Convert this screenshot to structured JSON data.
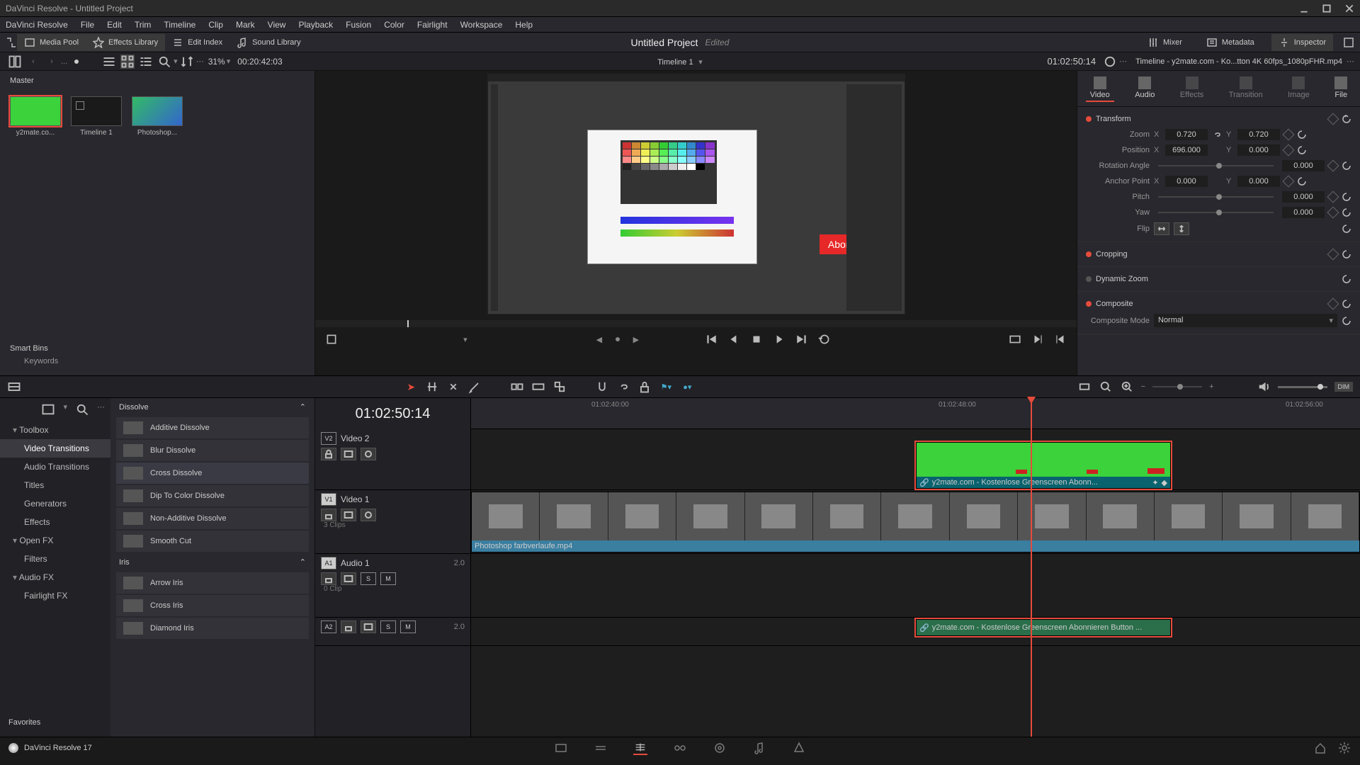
{
  "window": {
    "title": "DaVinci Resolve - Untitled Project"
  },
  "menu": [
    "DaVinci Resolve",
    "File",
    "Edit",
    "Trim",
    "Timeline",
    "Clip",
    "Mark",
    "View",
    "Playback",
    "Fusion",
    "Color",
    "Fairlight",
    "Workspace",
    "Help"
  ],
  "toolbar": {
    "media_pool": "Media Pool",
    "effects_library": "Effects Library",
    "edit_index": "Edit Index",
    "sound_library": "Sound Library",
    "mixer": "Mixer",
    "metadata": "Metadata",
    "inspector": "Inspector"
  },
  "project": {
    "name": "Untitled Project",
    "status": "Edited"
  },
  "subbar": {
    "zoom_pct": "31%",
    "src_tc": "00:20:42:03",
    "timeline_name": "Timeline 1",
    "rec_tc": "01:02:50:14",
    "insp_clip": "Timeline - y2mate.com - Ko...tton 4K 60fps_1080pFHR.mp4"
  },
  "pool": {
    "master": "Master",
    "smart_bins": "Smart Bins",
    "keywords": "Keywords",
    "clips": [
      {
        "name": "y2mate.co..."
      },
      {
        "name": "Timeline 1"
      },
      {
        "name": "Photoshop..."
      }
    ]
  },
  "viewer": {
    "abonnieren": "Abonnieren"
  },
  "inspector": {
    "tabs": {
      "video": "Video",
      "audio": "Audio",
      "effects": "Effects",
      "transition": "Transition",
      "image": "Image",
      "file": "File"
    },
    "transform": "Transform",
    "zoom_lbl": "Zoom",
    "zoom_x": "0.720",
    "zoom_y": "0.720",
    "position_lbl": "Position",
    "pos_x": "696.000",
    "pos_y": "0.000",
    "rotation_lbl": "Rotation Angle",
    "rotation": "0.000",
    "anchor_lbl": "Anchor Point",
    "anchor_x": "0.000",
    "anchor_y": "0.000",
    "pitch_lbl": "Pitch",
    "pitch": "0.000",
    "yaw_lbl": "Yaw",
    "yaw": "0.000",
    "flip_lbl": "Flip",
    "cropping": "Cropping",
    "dynamic_zoom": "Dynamic Zoom",
    "composite": "Composite",
    "composite_mode_lbl": "Composite Mode",
    "composite_mode": "Normal"
  },
  "fx": {
    "search": "",
    "side": {
      "toolbox": "Toolbox",
      "video_trans": "Video Transitions",
      "audio_trans": "Audio Transitions",
      "titles": "Titles",
      "generators": "Generators",
      "effects": "Effects",
      "openfx": "Open FX",
      "filters": "Filters",
      "audiofx": "Audio FX",
      "fairlightfx": "Fairlight FX",
      "favorites": "Favorites"
    },
    "groups": {
      "dissolve": "Dissolve",
      "iris": "Iris"
    },
    "dissolve_items": [
      "Additive Dissolve",
      "Blur Dissolve",
      "Cross Dissolve",
      "Dip To Color Dissolve",
      "Non-Additive Dissolve",
      "Smooth Cut"
    ],
    "iris_items": [
      "Arrow Iris",
      "Cross Iris",
      "Diamond Iris"
    ]
  },
  "timeline": {
    "big_tc": "01:02:50:14",
    "ruler": {
      "t1": "01:02:40:00",
      "t2": "01:02:48:00",
      "t3": "01:02:56:00"
    },
    "tracks": {
      "v2": {
        "id": "V2",
        "name": "Video 2"
      },
      "v1": {
        "id": "V1",
        "name": "Video 1",
        "info": "3 Clips"
      },
      "a1": {
        "id": "A1",
        "name": "Audio 1",
        "ch": "2.0",
        "info": "0 Clip"
      },
      "a2": {
        "id": "A2",
        "name": "",
        "ch": "2.0"
      }
    },
    "clips": {
      "v2_name": "y2mate.com - Kostenlose Greenscreen Abonn...",
      "v1_name": "Photoshop farbverlaufe.mp4",
      "a2_name": "y2mate.com - Kostenlose Greenscreen Abonnieren Button ..."
    }
  },
  "footer": {
    "app": "DaVinci Resolve 17"
  }
}
